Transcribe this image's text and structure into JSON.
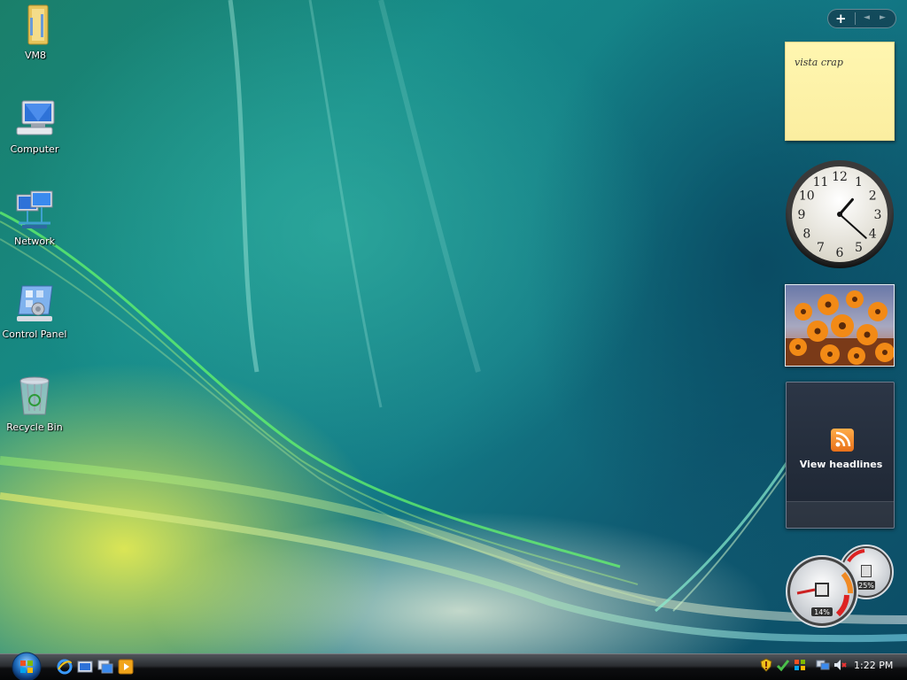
{
  "desktop": {
    "icons": [
      {
        "label": "VM8",
        "icon": "folder-icon"
      },
      {
        "label": "Computer",
        "icon": "computer-icon"
      },
      {
        "label": "Network",
        "icon": "network-icon"
      },
      {
        "label": "Control Panel",
        "icon": "control-panel-icon"
      },
      {
        "label": "Recycle Bin",
        "icon": "recycle-bin-icon"
      }
    ]
  },
  "sidebar": {
    "controls": {
      "add": "+",
      "prev": "◄",
      "next": "►"
    },
    "notes": {
      "text": "vista crap"
    },
    "clock": {
      "numerals": [
        "12",
        "1",
        "2",
        "3",
        "4",
        "5",
        "6",
        "7",
        "8",
        "9",
        "10",
        "11"
      ],
      "hour": 1,
      "minute": 22
    },
    "feed": {
      "label": "View headlines"
    },
    "cpu_meter": {
      "cpu": "14%",
      "memory": "25%"
    }
  },
  "taskbar": {
    "start_icon": "windows-orb-icon",
    "quick_launch": [
      "internet-explorer-icon",
      "show-desktop-icon",
      "switch-windows-icon",
      "media-player-icon"
    ],
    "tray_icons": [
      "security-alert-icon",
      "windows-update-icon",
      "windows-flag-icon",
      "network-connections-icon",
      "volume-muted-icon"
    ],
    "time": "1:22 PM"
  },
  "colors": {
    "note": "#fbeea0",
    "feed_orange": "#f08a24",
    "taskbar": "#1a1c20"
  }
}
